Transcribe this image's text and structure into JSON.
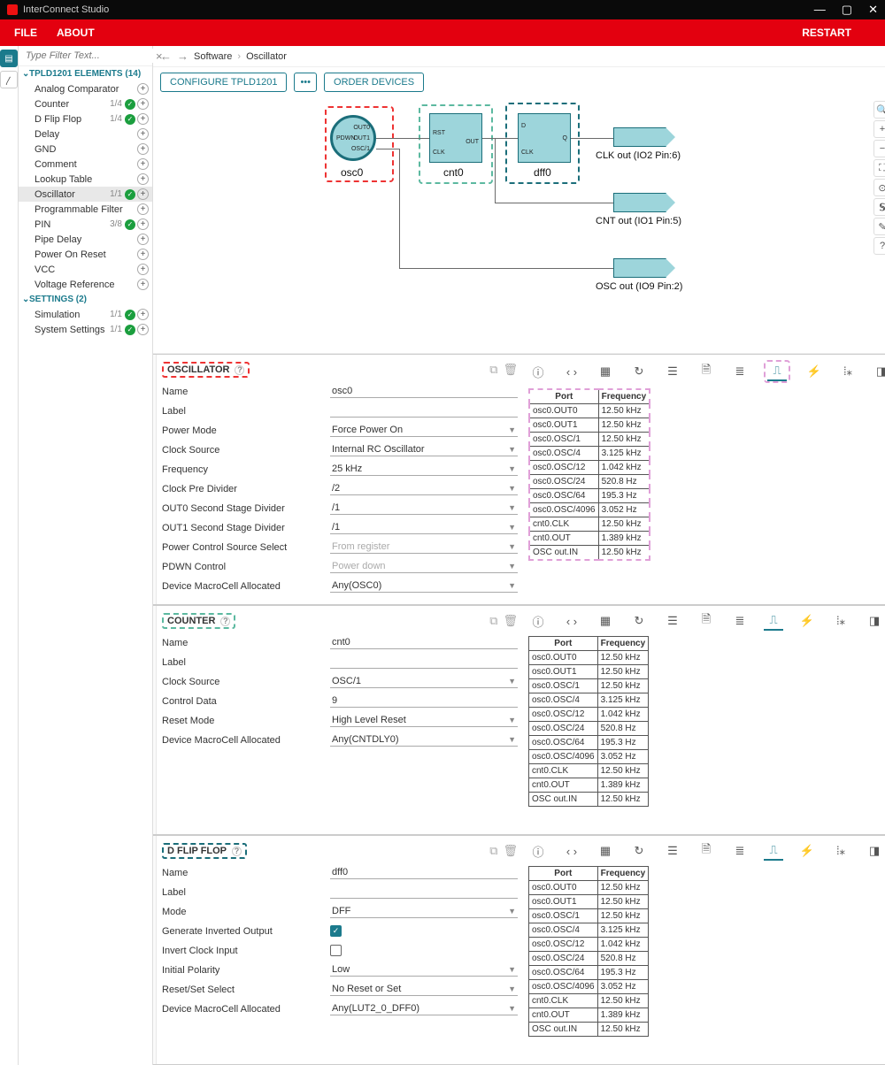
{
  "app": {
    "title": "InterConnect Studio"
  },
  "menu": {
    "file": "FILE",
    "about": "ABOUT",
    "restart": "RESTART"
  },
  "filter": {
    "placeholder": "Type Filter Text..."
  },
  "tree": {
    "elementsHeader": "TPLD1201 ELEMENTS (14)",
    "settingsHeader": "SETTINGS (2)",
    "elements": [
      {
        "nm": "Analog Comparator",
        "cnt": "",
        "chk": false
      },
      {
        "nm": "Counter",
        "cnt": "1/4",
        "chk": true
      },
      {
        "nm": "D Flip Flop",
        "cnt": "1/4",
        "chk": true
      },
      {
        "nm": "Delay",
        "cnt": "",
        "chk": false
      },
      {
        "nm": "GND",
        "cnt": "",
        "chk": false
      },
      {
        "nm": "Comment",
        "cnt": "",
        "chk": false
      },
      {
        "nm": "Lookup Table",
        "cnt": "",
        "chk": false
      },
      {
        "nm": "Oscillator",
        "cnt": "1/1",
        "chk": true,
        "sel": true
      },
      {
        "nm": "Programmable Filter",
        "cnt": "",
        "chk": false
      },
      {
        "nm": "PIN",
        "cnt": "3/8",
        "chk": true
      },
      {
        "nm": "Pipe Delay",
        "cnt": "",
        "chk": false
      },
      {
        "nm": "Power On Reset",
        "cnt": "",
        "chk": false
      },
      {
        "nm": "VCC",
        "cnt": "",
        "chk": false
      },
      {
        "nm": "Voltage Reference",
        "cnt": "",
        "chk": false
      }
    ],
    "settings": [
      {
        "nm": "Simulation",
        "cnt": "1/1",
        "chk": true
      },
      {
        "nm": "System Settings",
        "cnt": "1/1",
        "chk": true
      }
    ]
  },
  "crumbs": {
    "a": "Software",
    "b": "Oscillator"
  },
  "actions": {
    "configure": "CONFIGURE TPLD1201",
    "order": "ORDER DEVICES"
  },
  "canvas": {
    "osc": {
      "name": "osc0",
      "pdwn": "PDWN",
      "out0": "OUT0",
      "out1": "OUT1",
      "osc1": "OSC/1"
    },
    "cnt": {
      "name": "cnt0",
      "rst": "RST",
      "clk": "CLK",
      "out": "OUT"
    },
    "dff": {
      "name": "dff0",
      "d": "D",
      "clk": "CLK",
      "q": "Q"
    },
    "outs": {
      "clk": "CLK out (IO2 Pin:6)",
      "cnt": "CNT out (IO1 Pin:5)",
      "osc": "OSC out (IO9 Pin:2)"
    }
  },
  "panels": [
    {
      "key": "osc",
      "title": "OSCILLATOR",
      "box": "red",
      "rows": [
        {
          "lbl": "Name",
          "val": "osc0",
          "dd": false
        },
        {
          "lbl": "Label",
          "val": "",
          "dd": false
        },
        {
          "lbl": "Power Mode",
          "val": "Force Power On",
          "dd": true
        },
        {
          "lbl": "Clock Source",
          "val": "Internal RC Oscillator",
          "dd": true
        },
        {
          "lbl": "Frequency",
          "val": "25 kHz",
          "dd": true
        },
        {
          "lbl": "Clock Pre Divider",
          "val": "/2",
          "dd": true
        },
        {
          "lbl": "OUT0 Second Stage Divider",
          "val": "/1",
          "dd": true
        },
        {
          "lbl": "OUT1 Second Stage Divider",
          "val": "/1",
          "dd": true
        },
        {
          "lbl": "Power Control Source Select",
          "val": "From register",
          "dd": true,
          "dis": true
        },
        {
          "lbl": "PDWN Control",
          "val": "Power down",
          "dd": true,
          "dis": true
        },
        {
          "lbl": "Device MacroCell Allocated",
          "val": "Any(OSC0)",
          "dd": true
        }
      ],
      "pinkbox": true
    },
    {
      "key": "cnt",
      "title": "COUNTER",
      "box": "green",
      "rows": [
        {
          "lbl": "Name",
          "val": "cnt0",
          "dd": false
        },
        {
          "lbl": "Label",
          "val": "",
          "dd": false
        },
        {
          "lbl": "Clock Source",
          "val": "OSC/1",
          "dd": true
        },
        {
          "lbl": "Control Data",
          "val": "9",
          "dd": false
        },
        {
          "lbl": "Reset Mode",
          "val": "High Level Reset",
          "dd": true
        },
        {
          "lbl": "Device MacroCell Allocated",
          "val": "Any(CNTDLY0)",
          "dd": true
        }
      ]
    },
    {
      "key": "dff",
      "title": "D FLIP FLOP",
      "box": "teal",
      "rows": [
        {
          "lbl": "Name",
          "val": "dff0",
          "dd": false
        },
        {
          "lbl": "Label",
          "val": "",
          "dd": false
        },
        {
          "lbl": "Mode",
          "val": "DFF",
          "dd": true
        },
        {
          "lbl": "Generate Inverted Output",
          "cbx": true,
          "on": true
        },
        {
          "lbl": "Invert Clock Input",
          "cbx": true,
          "on": false
        },
        {
          "lbl": "Initial Polarity",
          "val": "Low",
          "dd": true
        },
        {
          "lbl": "Reset/Set Select",
          "val": "No Reset or Set",
          "dd": true
        },
        {
          "lbl": "Device MacroCell Allocated",
          "val": "Any(LUT2_0_DFF0)",
          "dd": true
        }
      ]
    }
  ],
  "freq": {
    "hdrPort": "Port",
    "hdrFreq": "Frequency",
    "rows": [
      {
        "p": "osc0.OUT0",
        "f": "12.50 kHz"
      },
      {
        "p": "osc0.OUT1",
        "f": "12.50 kHz"
      },
      {
        "p": "osc0.OSC/1",
        "f": "12.50 kHz"
      },
      {
        "p": "osc0.OSC/4",
        "f": "3.125 kHz"
      },
      {
        "p": "osc0.OSC/12",
        "f": "1.042 kHz"
      },
      {
        "p": "osc0.OSC/24",
        "f": "520.8 Hz"
      },
      {
        "p": "osc0.OSC/64",
        "f": "195.3 Hz"
      },
      {
        "p": "osc0.OSC/4096",
        "f": "3.052 Hz"
      },
      {
        "p": "cnt0.CLK",
        "f": "12.50 kHz"
      },
      {
        "p": "cnt0.OUT",
        "f": "1.389 kHz"
      },
      {
        "p": "OSC out.IN",
        "f": "12.50 kHz"
      }
    ]
  }
}
